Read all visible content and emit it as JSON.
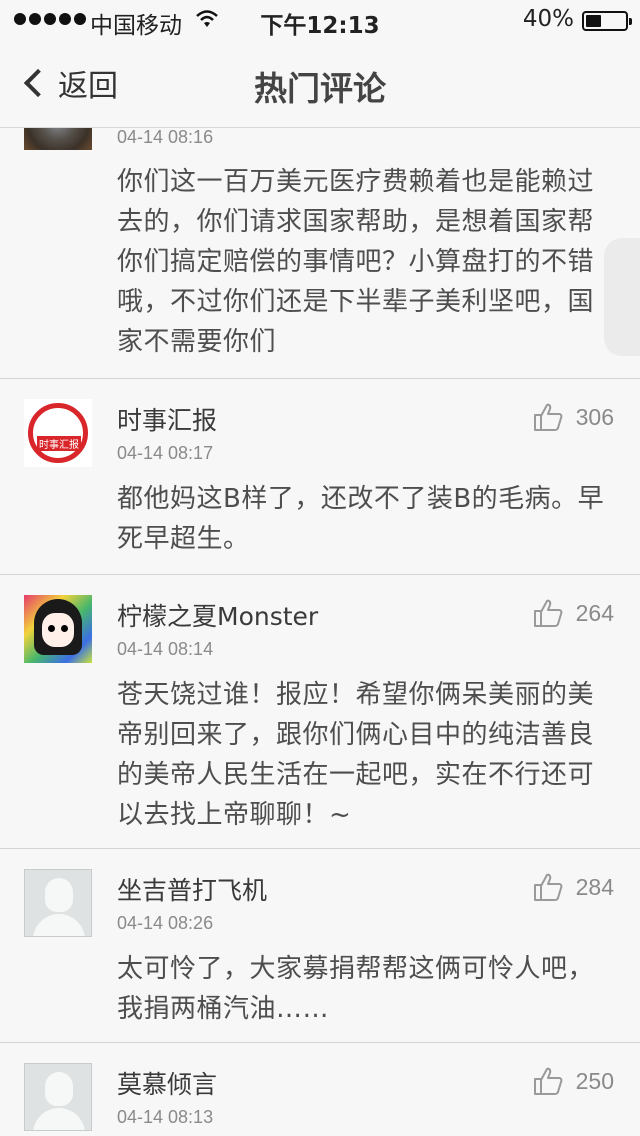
{
  "status_bar": {
    "carrier": "中国移动",
    "time": "下午12:13",
    "battery_percent": "40%",
    "battery_level": 0.4
  },
  "nav": {
    "back_label": "返回",
    "title": "热门评论"
  },
  "comments": [
    {
      "author": "",
      "time": "04-14 08:16",
      "likes": "",
      "avatar": "blurred-photo",
      "content": "你们这一百万美元医疗费赖着也是能赖过去的，你们请求国家帮助，是想着国家帮你们搞定赔偿的事情吧？小算盘打的不错哦，不过你们还是下半辈子美利坚吧，国家不需要你们"
    },
    {
      "author": "时事汇报",
      "time": "04-14 08:17",
      "likes": "306",
      "avatar": "news-logo",
      "avatar_text": "时事汇报",
      "content": "都他妈这B样了，还改不了装B的毛病。早死早超生。"
    },
    {
      "author": "柠檬之夏Monster",
      "time": "04-14 08:14",
      "likes": "264",
      "avatar": "cartoon-girl",
      "content": "苍天饶过谁！报应！希望你俩呆美丽的美帝别回来了，跟你们俩心目中的纯洁善良的美帝人民生活在一起吧，实在不行还可以去找上帝聊聊！~"
    },
    {
      "author": "坐吉普打飞机",
      "time": "04-14 08:26",
      "likes": "284",
      "avatar": "default-user",
      "content": "太可怜了，大家募捐帮帮这俩可怜人吧，我捐两桶汽油……"
    },
    {
      "author": "莫慕倾言",
      "time": "04-14 08:13",
      "likes": "250",
      "avatar": "default-user",
      "content": ""
    }
  ],
  "colors": {
    "background": "#f7f7f7",
    "text": "#4e4e4e",
    "meta": "#8a8a8a",
    "divider": "#d4d4d4",
    "news_red": "#d9262a"
  },
  "icons": {
    "like": "thumbs-up-icon",
    "back": "chevron-left-icon",
    "wifi": "wifi-icon",
    "battery": "battery-icon"
  }
}
